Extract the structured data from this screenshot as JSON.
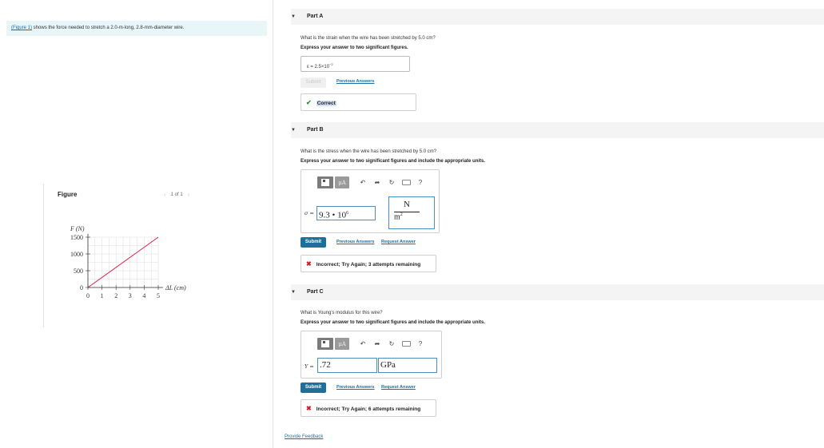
{
  "problem": {
    "figure_link": "(Figure 1)",
    "statement": " shows the force needed to stretch a 2.0-m-long, 2.8-mm-diameter wire."
  },
  "figure": {
    "title": "Figure",
    "pager": "1 of 1",
    "prev_icon": "chevron-left-icon",
    "next_icon": "chevron-right-icon"
  },
  "chart_data": {
    "type": "line",
    "x": [
      0,
      5
    ],
    "series": [
      {
        "values": [
          0,
          1500
        ],
        "color": "#e0224e"
      }
    ],
    "xlabel": "ΔL (cm)",
    "ylabel": "F (N)",
    "xlim": [
      0,
      5
    ],
    "ylim": [
      0,
      1500
    ],
    "xticks": [
      0,
      1,
      2,
      3,
      4,
      5
    ],
    "yticks": [
      0,
      500,
      1000,
      1500
    ],
    "grid": true
  },
  "partA": {
    "header": "Part A",
    "question": "What is the strain when the wire has been stretched by 5.0 cm?",
    "instruction": "Express your answer to two significant figures.",
    "answer_prefix": "ε = 2.5×10",
    "answer_exp": "−2",
    "submit_label": "Submit",
    "previous_answers": "Previous Answers",
    "feedback": "Correct"
  },
  "partB": {
    "header": "Part B",
    "question": "What is the stress when the wire has been stretched by 5.0 cm?",
    "instruction": "Express your answer to two significant figures and include the appropriate units.",
    "var_label": "σ =",
    "value_base": "9.3 • 10",
    "value_exp": "6",
    "unit_num": "N",
    "unit_den": "m",
    "unit_den_exp": "2",
    "submit_label": "Submit",
    "previous_answers": "Previous Answers",
    "request_answer": "Request Answer",
    "feedback": "Incorrect; Try Again; 3 attempts remaining"
  },
  "partC": {
    "header": "Part C",
    "question": "What is Young's modulus for this wire?",
    "instruction": "Express your answer to two significant figures and include the appropriate units.",
    "var_label": "Y =",
    "value": ".72",
    "unit": "GPa",
    "submit_label": "Submit",
    "previous_answers": "Previous Answers",
    "request_answer": "Request Answer",
    "feedback": "Incorrect; Try Again; 6 attempts remaining"
  },
  "toolbar": {
    "templates_icon": "templates-icon",
    "mu_label": "μA",
    "undo_icon": "undo-icon",
    "redo_icon": "redo-icon",
    "reset_icon": "reset-icon",
    "keyboard_icon": "keyboard-icon",
    "help_label": "?"
  },
  "footer": {
    "provide_feedback": "Provide Feedback"
  },
  "colors": {
    "accent": "#1f6f98",
    "correct": "#2e8b3a",
    "incorrect": "#d01c2a",
    "line": "#e0224e"
  }
}
